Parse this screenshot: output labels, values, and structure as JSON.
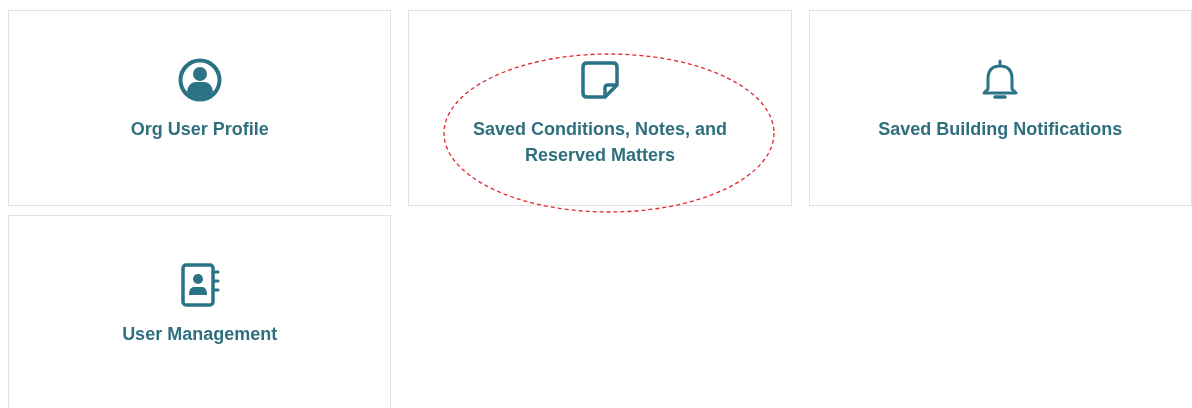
{
  "cards": [
    {
      "kind": "profile",
      "label": "Org User Profile",
      "circled": false
    },
    {
      "kind": "note",
      "label": "Saved Conditions, Notes, and Reserved Matters",
      "circled": true
    },
    {
      "kind": "bell",
      "label": "Saved Building Notifications",
      "circled": false
    },
    {
      "kind": "contacts",
      "label": "User Management",
      "circled": false
    }
  ]
}
